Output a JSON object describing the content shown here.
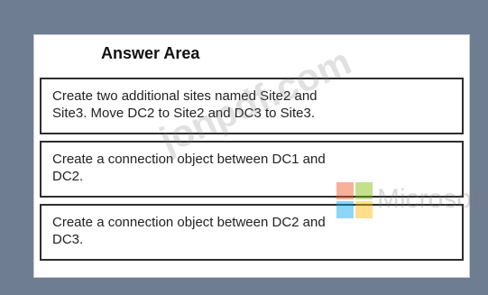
{
  "answer_area": {
    "title": "Answer Area",
    "items": [
      {
        "line1": "Create two additional sites named Site2 and",
        "line2": "Site3. Move DC2 to Site2 and DC3 to Site3."
      },
      {
        "line1": "Create a connection object between DC1 and",
        "line2": "DC2."
      },
      {
        "line1": "Create a connection object between DC2 and",
        "line2": "DC3."
      }
    ]
  },
  "overlay": {
    "watermark_text": "jonpdf.com",
    "brand_text": "Microsoft"
  },
  "colors": {
    "background": "#6f7d92",
    "panel": "#ffffff",
    "item_border": "#2e2e2e",
    "logo_red": "#f15022",
    "logo_green": "#7fba00",
    "logo_blue": "#00a4ef",
    "logo_yellow": "#ffb900"
  }
}
